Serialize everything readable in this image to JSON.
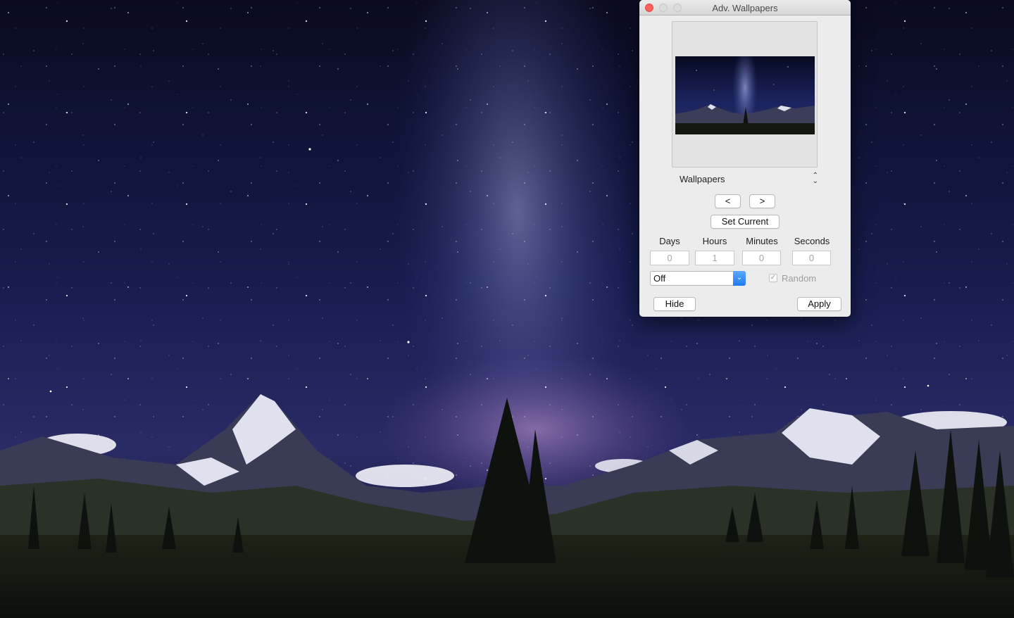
{
  "window": {
    "title": "Adv. Wallpapers",
    "source_selected": "Wallpapers",
    "prev_label": "<",
    "next_label": ">",
    "set_current_label": "Set Current",
    "interval": {
      "labels": [
        "Days",
        "Hours",
        "Minutes",
        "Seconds"
      ],
      "values": [
        "0",
        "1",
        "0",
        "0"
      ]
    },
    "mode_selected": "Off",
    "random_label": "Random",
    "random_checked": true,
    "hide_label": "Hide",
    "apply_label": "Apply"
  },
  "icons": {
    "source_select": "up-down-chevron-icon",
    "mode_select": "chevron-down-icon",
    "random": "checkmark-icon"
  },
  "colors": {
    "accent": "#2a86f5",
    "close_button": "#fc605c",
    "sky_top": "#0b0c22",
    "milky_way": "#6b6fb4"
  }
}
